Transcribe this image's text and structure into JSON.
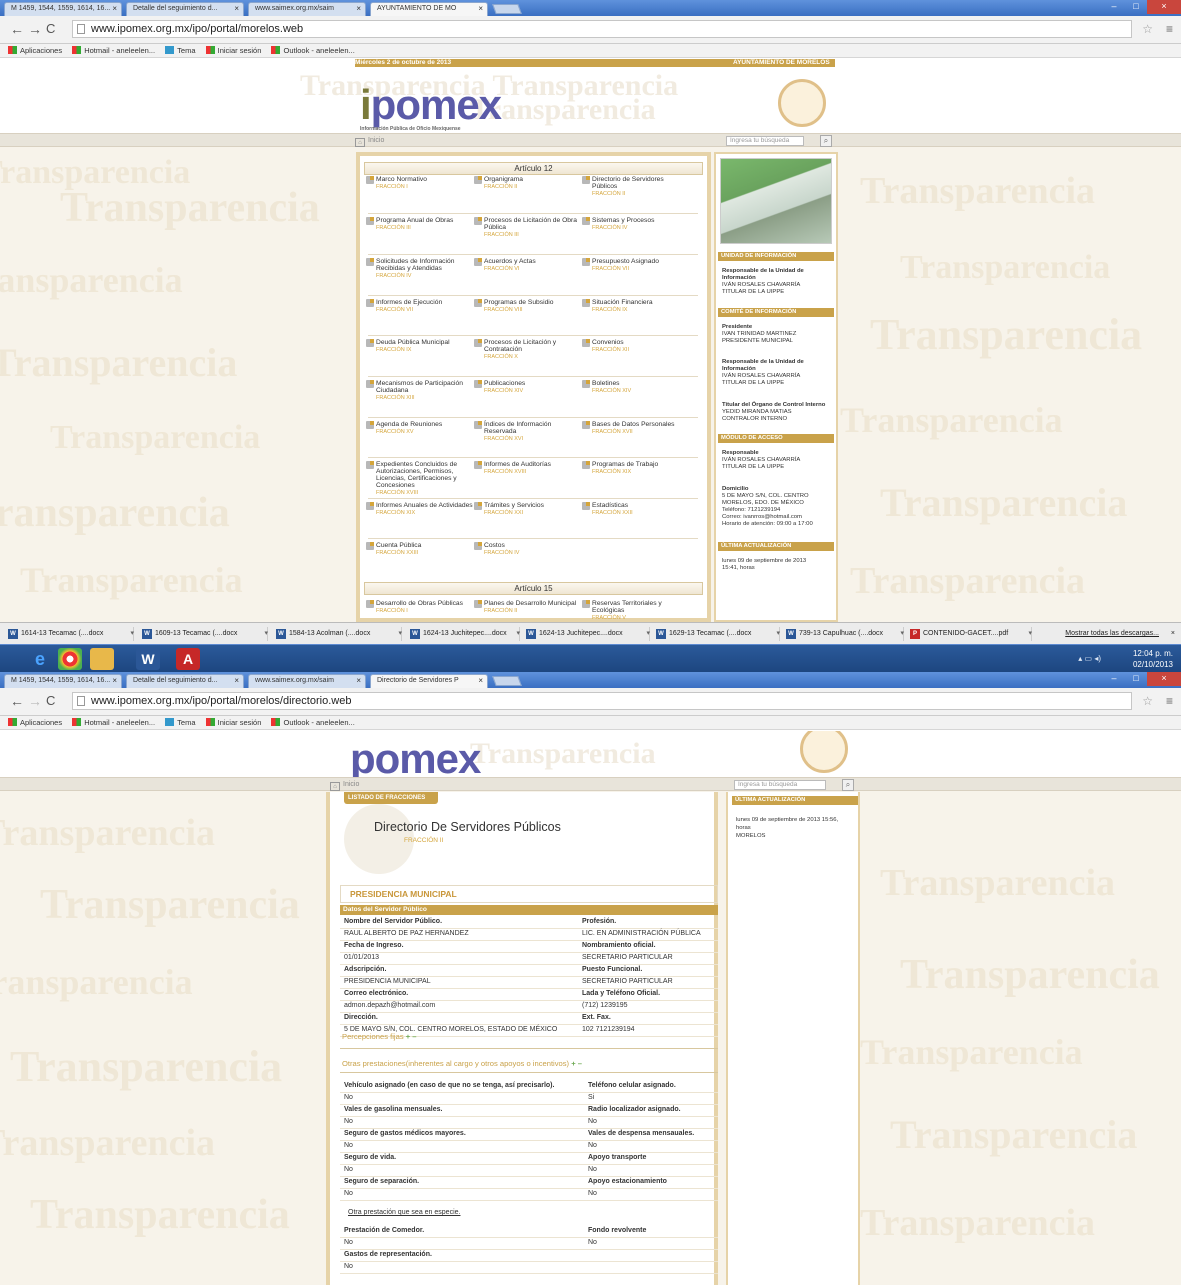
{
  "shot1": {
    "tabs": [
      {
        "label": "M 1459, 1544, 1559, 1614, 16..."
      },
      {
        "label": "Detalle del seguimiento d..."
      },
      {
        "label": "www.saimex.org.mx/saim"
      },
      {
        "label": "AYUNTAMIENTO DE MO"
      }
    ],
    "url": "www.ipomex.org.mx/ipo/portal/morelos.web",
    "bookmarks": [
      "Aplicaciones",
      "Hotmail - aneleelen...",
      "Tema",
      "Iniciar sesión",
      "Outlook - aneleelen..."
    ],
    "date": "Miércoles 2 de octubre de 2013",
    "entity": "AYUNTAMIENTO DE MORELOS",
    "logo": {
      "text": "pomex",
      "i": "i",
      "tagline": "Información Pública de Oficio Mexiquense"
    },
    "nav_home": "Inicio",
    "search_placeholder": "Ingresa tu búsqueda",
    "section12": "Artículo 12",
    "section15": "Artículo 15",
    "fractions": [
      {
        "t": "Marco Normativo",
        "f": "FRACCIÓN I"
      },
      {
        "t": "Organigrama",
        "f": "FRACCIÓN II"
      },
      {
        "t": "Directorio de Servidores Públicos",
        "f": "FRACCIÓN II"
      },
      {
        "t": "Programa Anual de Obras",
        "f": "FRACCIÓN III"
      },
      {
        "t": "Procesos de Licitación de Obra Pública",
        "f": "FRACCIÓN III"
      },
      {
        "t": "Sistemas y Procesos",
        "f": "FRACCIÓN IV"
      },
      {
        "t": "Solicitudes de Información Recibidas y Atendidas",
        "f": "FRACCIÓN IV"
      },
      {
        "t": "Acuerdos y Actas",
        "f": "FRACCIÓN VI"
      },
      {
        "t": "Presupuesto Asignado",
        "f": "FRACCIÓN VII"
      },
      {
        "t": "Informes de Ejecución",
        "f": "FRACCIÓN VII"
      },
      {
        "t": "Programas de Subsidio",
        "f": "FRACCIÓN VIII"
      },
      {
        "t": "Situación Financiera",
        "f": "FRACCIÓN IX"
      },
      {
        "t": "Deuda Pública Municipal",
        "f": "FRACCIÓN IX"
      },
      {
        "t": "Procesos de Licitación y Contratación",
        "f": "FRACCIÓN X"
      },
      {
        "t": "Convenios",
        "f": "FRACCIÓN XII"
      },
      {
        "t": "Mecanismos de Participación Ciudadana",
        "f": "FRACCIÓN XIII"
      },
      {
        "t": "Publicaciones",
        "f": "FRACCIÓN XIV"
      },
      {
        "t": "Boletines",
        "f": "FRACCIÓN XIV"
      },
      {
        "t": "Agenda de Reuniones",
        "f": "FRACCIÓN XV"
      },
      {
        "t": "Índices de Información Reservada",
        "f": "FRACCIÓN XVI"
      },
      {
        "t": "Bases de Datos Personales",
        "f": "FRACCIÓN XVII"
      },
      {
        "t": "Expedientes Concluidos de Autorizaciones, Permisos, Licencias, Certificaciones y Concesiones",
        "f": "FRACCIÓN XVIII"
      },
      {
        "t": "Informes de Auditorías",
        "f": "FRACCIÓN XVIII"
      },
      {
        "t": "Programas de Trabajo",
        "f": "FRACCIÓN XIX"
      },
      {
        "t": "Informes Anuales de Actividades",
        "f": "FRACCIÓN XIX"
      },
      {
        "t": "Trámites y Servicios",
        "f": "FRACCIÓN XXI"
      },
      {
        "t": "Estadísticas",
        "f": "FRACCIÓN XXII"
      },
      {
        "t": "Cuenta Pública",
        "f": "FRACCIÓN XXIII"
      },
      {
        "t": "Costos",
        "f": "FRACCIÓN IV"
      }
    ],
    "fractions15": [
      {
        "t": "Desarrollo de Obras Públicas",
        "f": "FRACCIÓN I"
      },
      {
        "t": "Planes de Desarrollo Municipal",
        "f": "FRACCIÓN II"
      },
      {
        "t": "Reservas Territoriales y Ecológicas",
        "f": "FRACCIÓN V"
      }
    ],
    "side": {
      "h_unidad": "UNIDAD DE INFORMACIÓN",
      "unidad": [
        "Responsable de la Unidad de Información",
        "IVÁN ROSALES CHAVARRÍA",
        "TITULAR DE LA UIPPE"
      ],
      "h_comite": "COMITÉ DE INFORMACIÓN",
      "pres": [
        "Presidente",
        "IVAN TRINIDAD MARTINEZ",
        "PRESIDENTE MUNICIPAL"
      ],
      "resp": [
        "Responsable de la Unidad de Información",
        "IVÁN ROSALES CHAVARRÍA",
        "TITULAR DE LA UIPPE"
      ],
      "tit": [
        "Titular del Órgano de Control Interno",
        "YEDID MIRANDA MATIAS",
        "CONTRALOR INTERNO"
      ],
      "h_modulo": "MÓDULO DE ACCESO",
      "modulo": [
        "Responsable",
        "IVÁN ROSALES CHAVARRÍA",
        "TITULAR DE LA UIPPE"
      ],
      "dom": [
        "Domicilio",
        "5 DE MAYO S/N, COL. CENTRO",
        "MORELOS, EDO. DE MÉXICO",
        "Teléfono: 7121239194",
        "Correo: ivanrros@hotmail.com",
        "Horario de atención: 09:00 a 17:00"
      ],
      "h_ultima": "ÚLTIMA ACTUALIZACIÓN",
      "ultima": [
        "lunes 09 de septiembre de 2013",
        "15:41, horas"
      ]
    },
    "downloads": [
      "1614-13 Tecamac (....docx",
      "1609-13 Tecamac (....docx",
      "1584-13 Acolman (....docx",
      "1624-13 Juchitepec....docx",
      "1624-13 Juchitepec....docx",
      "1629-13 Tecamac (....docx",
      "739-13 Capulhuac (....docx",
      "CONTENIDO-GACET....pdf"
    ],
    "show_all": "Mostrar todas las descargas...",
    "clock": [
      "12:04 p. m.",
      "02/10/2013"
    ]
  },
  "shot2": {
    "tabs": [
      {
        "label": "M 1459, 1544, 1559, 1614, 16..."
      },
      {
        "label": "Detalle del seguimiento d..."
      },
      {
        "label": "www.saimex.org.mx/saim"
      },
      {
        "label": "Directorio de Servidores P"
      }
    ],
    "url": "www.ipomex.org.mx/ipo/portal/morelos/directorio.web",
    "list_tab": "LISTADO DE FRACCIONES",
    "title": "Directorio De Servidores Públicos",
    "subtitle": "FRACCIÓN II",
    "office": "PRESIDENCIA MUNICIPAL",
    "datos": "Datos del Servidor Público",
    "fields": [
      [
        "Nombre del Servidor Público.",
        "Profesión."
      ],
      [
        "RAUL ALBERTO DE PAZ HERNANDEZ",
        "LIC. EN ADMINISTRACIÓN PÚBLICA"
      ],
      [
        "Fecha de Ingreso.",
        "Nombramiento oficial."
      ],
      [
        "01/01/2013",
        "SECRETARIO PARTICULAR"
      ],
      [
        "Adscripción.",
        "Puesto Funcional."
      ],
      [
        "PRESIDENCIA MUNICIPAL",
        "SECRETARIO PARTICULAR"
      ],
      [
        "Correo electrónico.",
        "Lada y Teléfono Oficial."
      ],
      [
        "admon.depazh@hotmail.com",
        "(712) 1239195"
      ],
      [
        "Dirección.",
        "Ext. Fax."
      ],
      [
        "5 DE MAYO S/N, COL. CENTRO MORELOS, ESTADO DE MÉXICO",
        "102 7121239194"
      ]
    ],
    "percep": "Percepciones fijas",
    "otras": "Otras prestaciones(inherentes al cargo y otros apoyos o incentivos)",
    "benefits": [
      [
        "Vehículo asignado (en caso de que no se tenga, así precisarlo).",
        "Teléfono celular asignado."
      ],
      [
        "No",
        "Si"
      ],
      [
        "Vales de gasolina mensuales.",
        "Radio localizador asignado."
      ],
      [
        "No",
        "No"
      ],
      [
        "Seguro de gastos médicos mayores.",
        "Vales de despensa mensauales."
      ],
      [
        "No",
        "No"
      ],
      [
        "Seguro de vida.",
        "Apoyo transporte"
      ],
      [
        "No",
        "No"
      ],
      [
        "Seguro de separación.",
        "Apoyo estacionamiento"
      ],
      [
        "No",
        "No"
      ]
    ],
    "otra_especie": "Otra prestación que sea en especie.",
    "benefits2": [
      [
        "Prestación de Comedor.",
        "Fondo revolvente"
      ],
      [
        "No",
        "No"
      ],
      [
        "Gastos de representación.",
        ""
      ],
      [
        "No",
        ""
      ]
    ],
    "side_h": "ÚLTIMA ACTUALIZACIÓN",
    "side": [
      "lunes 09 de septiembre de 2013 15:56,",
      "horas",
      "MORELOS"
    ]
  }
}
